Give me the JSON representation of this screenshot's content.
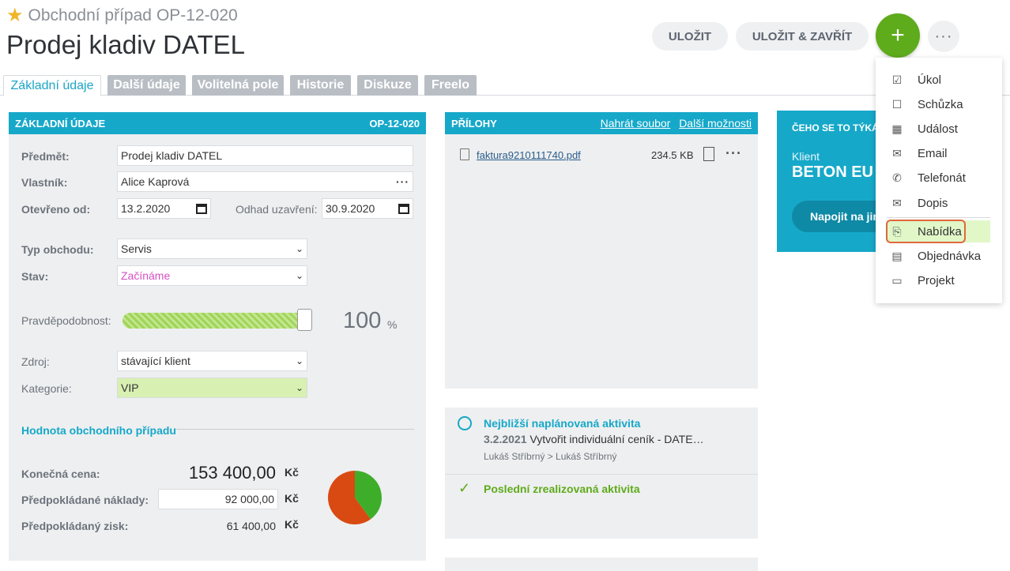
{
  "header": {
    "breadcrumb_label": "Obchodní případ",
    "record_id": "OP-12-020",
    "title": "Prodej kladiv DATEL",
    "save_label": "ULOŽIT",
    "save_close_label": "ULOŽIT & ZAVŘÍT",
    "add_label": "+",
    "more_label": "···"
  },
  "tabs": [
    "Základní údaje",
    "Další údaje",
    "Volitelná pole",
    "Historie",
    "Diskuze",
    "Freelo"
  ],
  "basic": {
    "header": "ZÁKLADNÍ ÚDAJE",
    "header_id": "OP-12-020",
    "subject_label": "Předmět:",
    "subject_value": "Prodej kladiv DATEL",
    "owner_label": "Vlastník:",
    "owner_value": "Alice Kaprová",
    "opened_label": "Otevřeno od:",
    "opened_value": "13.2.2020",
    "close_label": "Odhad uzavření:",
    "close_value": "30.9.2020",
    "type_label": "Typ obchodu:",
    "type_value": "Servis",
    "state_label": "Stav:",
    "state_value": "Začínáme",
    "prob_label": "Pravděpodobnost:",
    "prob_value": "100",
    "prob_unit": "%",
    "prob_fraction": 1.0,
    "source_label": "Zdroj:",
    "source_value": "stávající klient",
    "category_label": "Kategorie:",
    "category_value": "VIP",
    "value_section": "Hodnota obchodního případu",
    "final_label": "Konečná cena:",
    "final_value": "153 400,00",
    "cost_label": "Předpokládané náklady:",
    "cost_value": "92 000,00",
    "profit_label": "Předpokládaný zisk:",
    "profit_value": "61 400,00",
    "currency": "Kč"
  },
  "chart_data": {
    "type": "pie",
    "values": [
      92000,
      61400
    ],
    "colors": [
      "#d94a12",
      "#3eae2a"
    ]
  },
  "attachments": {
    "header": "PŘÍLOHY",
    "upload_label": "Nahrát soubor",
    "more_label": "Další možnosti",
    "file_name": "faktura9210111740.pdf",
    "file_size": "234.5 KB"
  },
  "activity": {
    "next_title": "Nejbližší naplánovaná aktivita",
    "next_date": "3.2.2021",
    "next_desc": "Vytvořit individuální ceník - DATE…",
    "next_people": "Lukáš Stříbrný > Lukáš Stříbrný",
    "last_title": "Poslední zrealizovaná aktivita"
  },
  "related": {
    "header": "ČEHO SE TO TÝKÁ",
    "client_label": "Klient",
    "client_value": "BETON EU",
    "connect_label": "Napojit na jiný"
  },
  "menu": [
    {
      "icon": "task-icon",
      "label": "Úkol"
    },
    {
      "icon": "meeting-icon",
      "label": "Schůzka"
    },
    {
      "icon": "calendar-icon",
      "label": "Událost"
    },
    {
      "icon": "email-icon",
      "label": "Email"
    },
    {
      "icon": "phone-icon",
      "label": "Telefonát"
    },
    {
      "icon": "letter-icon",
      "label": "Dopis"
    },
    {
      "icon": "offer-icon",
      "label": "Nabídka"
    },
    {
      "icon": "order-icon",
      "label": "Objednávka"
    },
    {
      "icon": "folder-icon",
      "label": "Projekt"
    }
  ]
}
